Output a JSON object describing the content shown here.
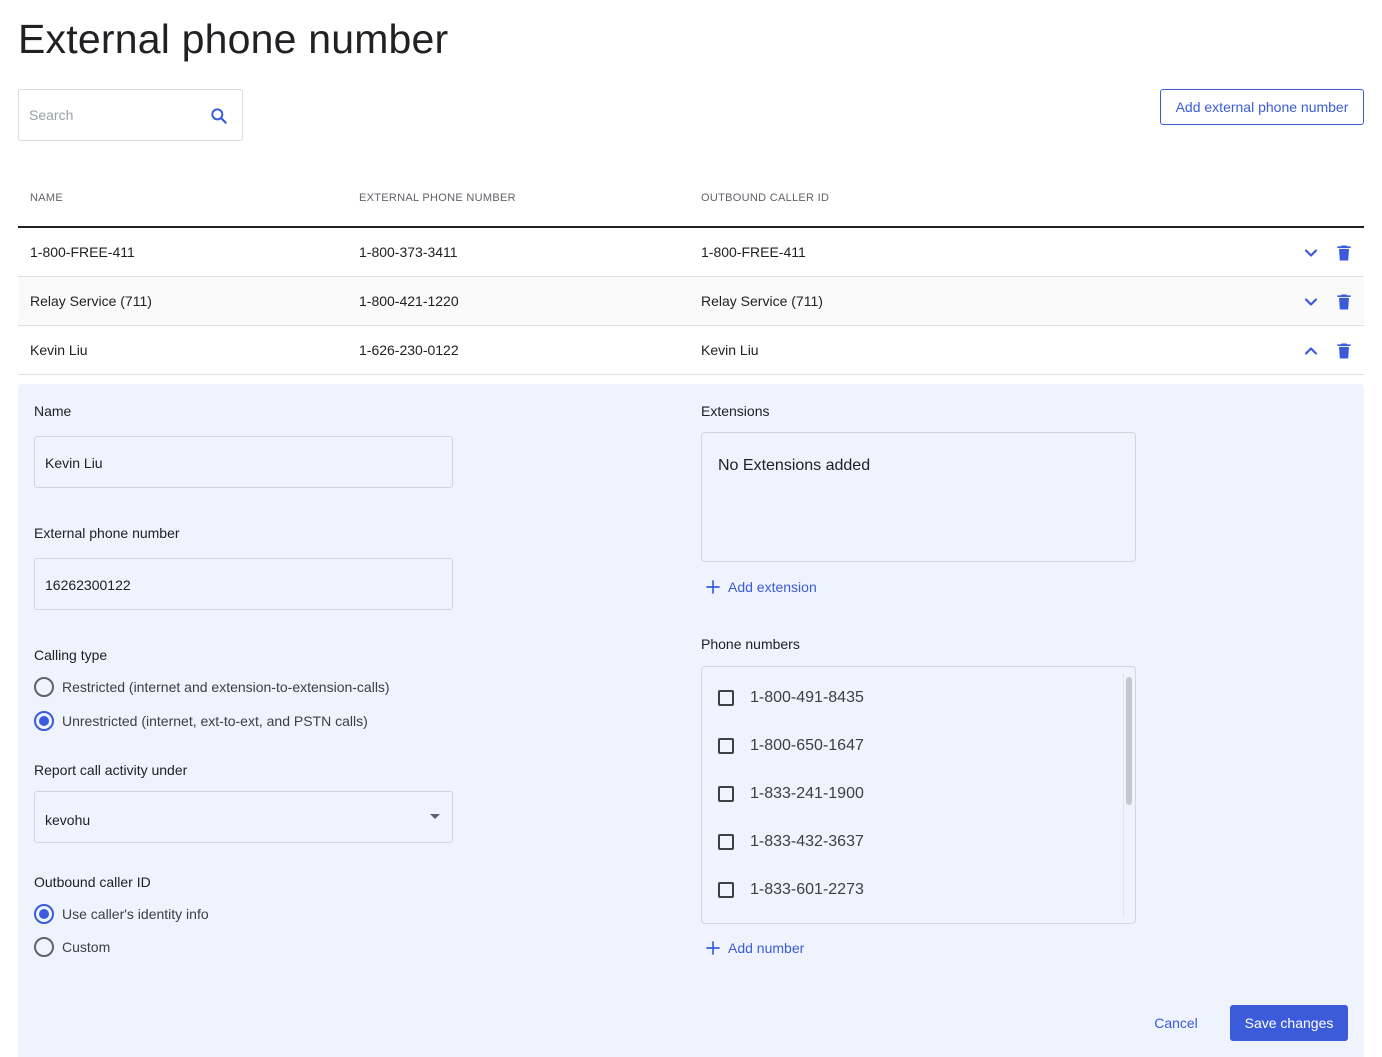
{
  "page": {
    "title": "External phone number"
  },
  "search": {
    "placeholder": "Search",
    "value": ""
  },
  "toolbar": {
    "add_label": "Add external phone number"
  },
  "table": {
    "columns": [
      "NAME",
      "EXTERNAL PHONE NUMBER",
      "OUTBOUND CALLER ID"
    ],
    "rows": [
      {
        "name": "1-800-FREE-411",
        "number": "1-800-373-3411",
        "caller_id": "1-800-FREE-411",
        "expanded": false
      },
      {
        "name": "Relay Service (711)",
        "number": "1-800-421-1220",
        "caller_id": "Relay Service (711)",
        "expanded": false
      },
      {
        "name": "Kevin Liu",
        "number": "1-626-230-0122",
        "caller_id": "Kevin Liu",
        "expanded": true
      }
    ]
  },
  "detail": {
    "name_label": "Name",
    "name_value": "Kevin Liu",
    "number_label": "External phone number",
    "number_value": "16262300122",
    "calling_type_label": "Calling type",
    "calling_types": [
      {
        "label": "Restricted (internet and extension-to-extension-calls)",
        "selected": false
      },
      {
        "label": "Unrestricted (internet, ext-to-ext, and PSTN calls)",
        "selected": true
      }
    ],
    "report_label": "Report call activity under",
    "report_value": "kevohu",
    "caller_id_label": "Outbound caller ID",
    "caller_id_options": [
      {
        "label": "Use caller's identity info",
        "selected": true
      },
      {
        "label": "Custom",
        "selected": false
      }
    ],
    "extensions_label": "Extensions",
    "extensions_empty": "No Extensions added",
    "add_extension_label": "Add extension",
    "phone_numbers_label": "Phone numbers",
    "phone_numbers": [
      {
        "number": "1-800-491-8435",
        "checked": false
      },
      {
        "number": "1-800-650-1647",
        "checked": false
      },
      {
        "number": "1-833-241-1900",
        "checked": false
      },
      {
        "number": "1-833-432-3637",
        "checked": false
      },
      {
        "number": "1-833-601-2273",
        "checked": false
      }
    ],
    "add_number_label": "Add number",
    "cancel_label": "Cancel",
    "save_label": "Save changes"
  },
  "colors": {
    "accent": "#3b5bdb",
    "panel_bg": "#eef3fd",
    "text": "#202124"
  }
}
